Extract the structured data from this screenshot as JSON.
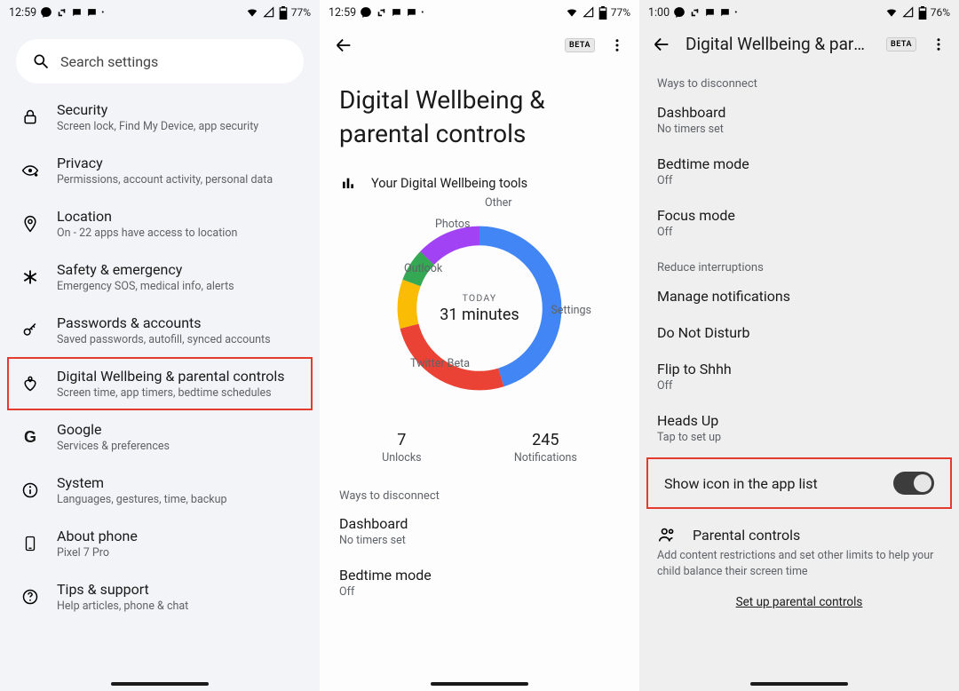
{
  "status": {
    "p12": {
      "time": "12:59",
      "battery": "77%"
    },
    "p3": {
      "time": "1:00",
      "battery": "76%"
    }
  },
  "search": {
    "placeholder": "Search settings"
  },
  "settings_rows": [
    {
      "icon": "lock",
      "title": "Security",
      "sub": "Screen lock, Find My Device, app security"
    },
    {
      "icon": "eye",
      "title": "Privacy",
      "sub": "Permissions, account activity, personal data"
    },
    {
      "icon": "pin",
      "title": "Location",
      "sub": "On - 22 apps have access to location"
    },
    {
      "icon": "asterisk",
      "title": "Safety & emergency",
      "sub": "Emergency SOS, medical info, alerts"
    },
    {
      "icon": "key",
      "title": "Passwords & accounts",
      "sub": "Saved passwords, autofill, synced accounts"
    },
    {
      "icon": "heart",
      "title": "Digital Wellbeing & parental controls",
      "sub": "Screen time, app timers, bedtime schedules",
      "highlight": true
    },
    {
      "icon": "g",
      "title": "Google",
      "sub": "Services & preferences"
    },
    {
      "icon": "info",
      "title": "System",
      "sub": "Languages, gestures, time, backup"
    },
    {
      "icon": "phone",
      "title": "About phone",
      "sub": "Pixel 7 Pro"
    },
    {
      "icon": "help",
      "title": "Tips & support",
      "sub": "Help articles, phone & chat"
    }
  ],
  "pane2": {
    "beta": "BETA",
    "title": "Digital Wellbeing & parental controls",
    "tools_header": "Your Digital Wellbeing tools",
    "donut": {
      "today": "TODAY",
      "minutes": "31 minutes",
      "labels": [
        "Other",
        "Photos",
        "Outlook",
        "Twitter Beta",
        "Settings"
      ]
    },
    "stats": [
      {
        "num": "7",
        "lab": "Unlocks"
      },
      {
        "num": "245",
        "lab": "Notifications"
      }
    ],
    "disconnect_header": "Ways to disconnect",
    "items": [
      {
        "t": "Dashboard",
        "s": "No timers set"
      },
      {
        "t": "Bedtime mode",
        "s": "Off"
      }
    ]
  },
  "pane3": {
    "title": "Digital Wellbeing & pare...",
    "beta": "BETA",
    "disconnect_header": "Ways to disconnect",
    "disconnect": [
      {
        "t": "Dashboard",
        "s": "No timers set"
      },
      {
        "t": "Bedtime mode",
        "s": "Off"
      },
      {
        "t": "Focus mode",
        "s": "Off"
      }
    ],
    "reduce_header": "Reduce interruptions",
    "reduce": [
      {
        "t": "Manage notifications"
      },
      {
        "t": "Do Not Disturb"
      },
      {
        "t": "Flip to Shhh",
        "s": "Off"
      },
      {
        "t": "Heads Up",
        "s": "Tap to set up"
      }
    ],
    "toggle_label": "Show icon in the app list",
    "parental": {
      "title": "Parental controls",
      "sub": "Add content restrictions and set other limits to help your child balance their screen time",
      "link": "Set up parental controls"
    }
  },
  "chart_data": {
    "type": "pie",
    "title": "Today — 31 minutes",
    "categories": [
      "Settings",
      "Twitter Beta",
      "Outlook",
      "Photos",
      "Other"
    ],
    "values": [
      14,
      8,
      3,
      2,
      4
    ],
    "series_colors": [
      "#4285F4",
      "#EA4335",
      "#FBBC05",
      "#34A853",
      "#A142F4"
    ],
    "unit": "minutes"
  }
}
